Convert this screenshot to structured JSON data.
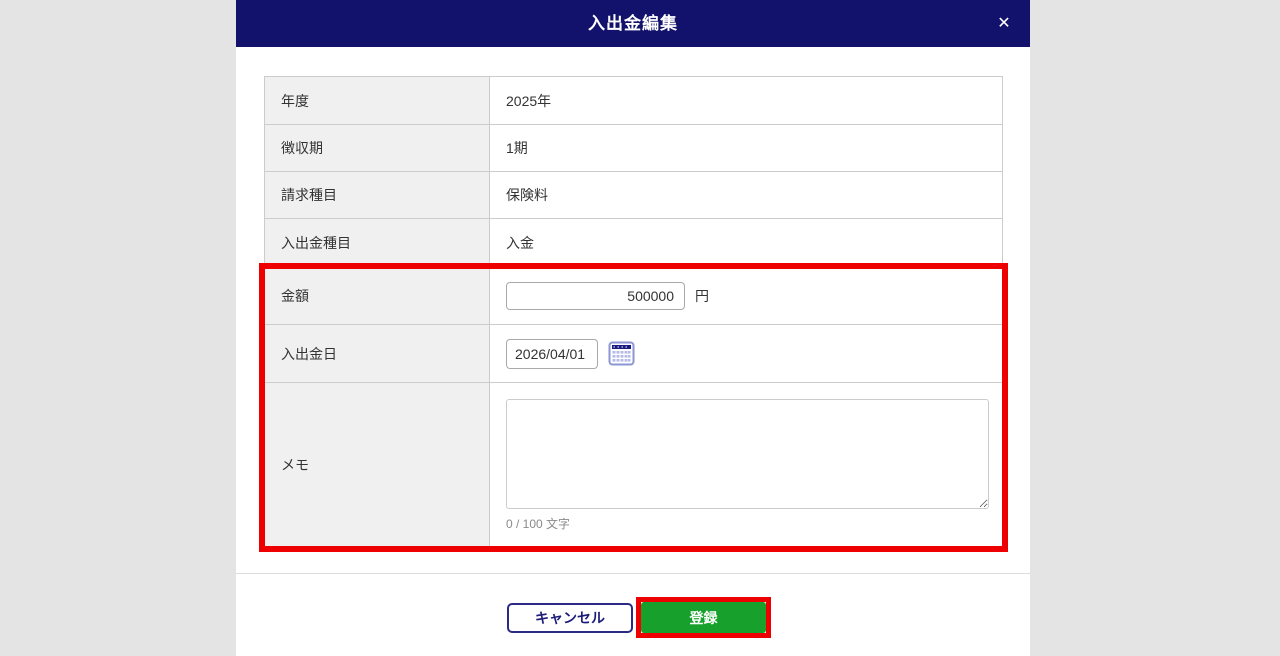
{
  "modal": {
    "title": "入出金編集",
    "close_icon": "✕"
  },
  "form": {
    "rows": [
      {
        "label": "年度",
        "value": "2025年"
      },
      {
        "label": "徴収期",
        "value": "1期"
      },
      {
        "label": "請求種目",
        "value": "保険料"
      },
      {
        "label": "入出金種目",
        "value": "入金"
      },
      {
        "label": "金額",
        "input_value": "500000",
        "unit": "円"
      },
      {
        "label": "入出金日",
        "input_value": "2026/04/01",
        "icon": "calendar-icon"
      },
      {
        "label": "メモ",
        "textarea_value": "",
        "counter": "0 / 100 文字"
      }
    ]
  },
  "footer": {
    "cancel_label": "キャンセル",
    "submit_label": "登録"
  },
  "colors": {
    "header_bg": "#12126d",
    "submit_green": "#17a02b",
    "annotation_red": "#ee0000",
    "cancel_border": "#2b2b85",
    "label_cell_bg": "#f0f0f0"
  }
}
